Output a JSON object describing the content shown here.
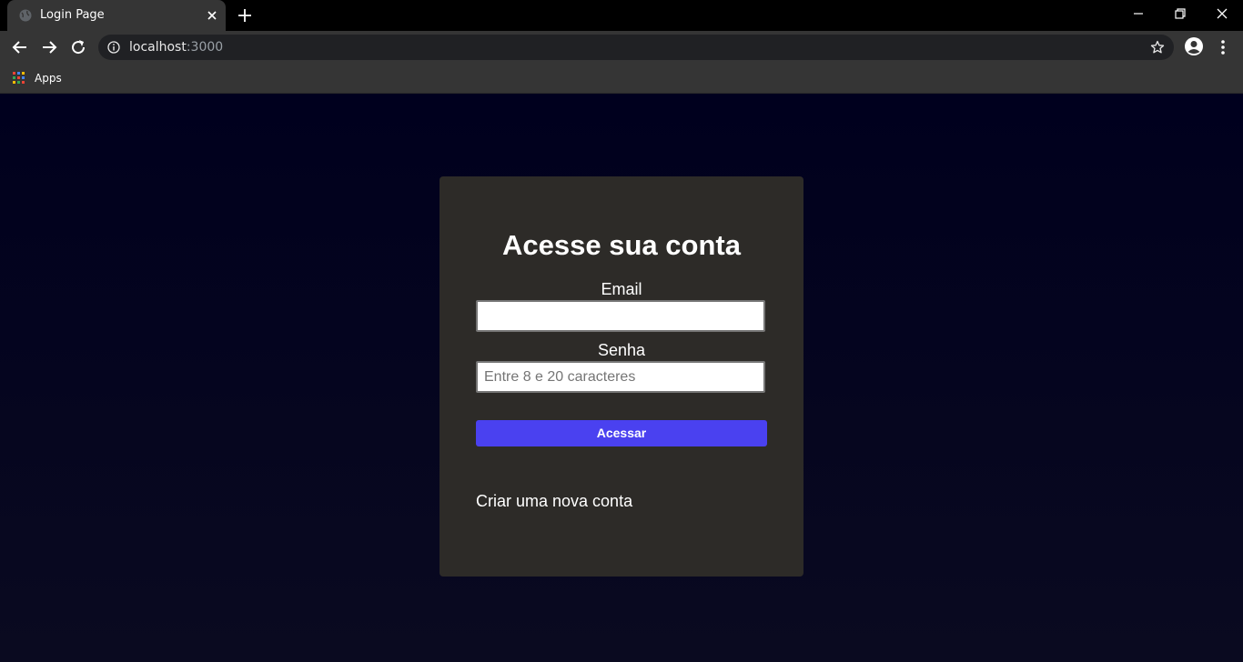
{
  "browser": {
    "tab_title": "Login Page",
    "url_host": "localhost",
    "url_port": ":3000",
    "bookmarks": [
      {
        "label": "Apps",
        "icon": "apps-grid-icon"
      }
    ]
  },
  "page": {
    "title": "Acesse sua conta",
    "email": {
      "label": "Email",
      "value": "",
      "placeholder": ""
    },
    "password": {
      "label": "Senha",
      "value": "",
      "placeholder": "Entre 8 e 20 caracteres"
    },
    "submit_label": "Acessar",
    "create_account_link": "Criar uma nova conta"
  },
  "colors": {
    "page_background": "#00001e",
    "card_background": "#2d2b28",
    "button_accent": "#4a41f0",
    "chrome_background": "#353535"
  }
}
